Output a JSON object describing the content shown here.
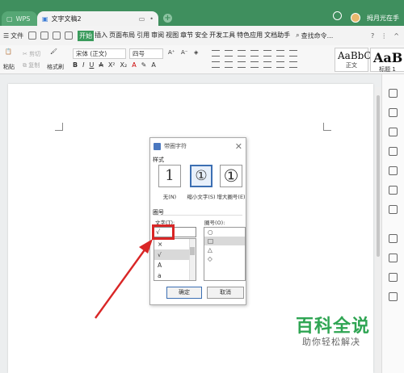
{
  "titlebar": {
    "app_tab": "WPS",
    "doc_tab": "文字文稿2",
    "user_name": "拇月光在手"
  },
  "menubar": {
    "file_label": "文件",
    "tabs": [
      "开始",
      "插入",
      "页面布局",
      "引用",
      "审阅",
      "视图",
      "章节",
      "安全",
      "开发工具",
      "特色应用",
      "文档助手"
    ],
    "search_label": "查找命令..."
  },
  "ribbon": {
    "paste_label": "粘贴",
    "cut_label": "剪切",
    "copy_label": "复制",
    "format_painter_label": "格式刷",
    "font_name": "宋体 (正文)",
    "font_size": "四号",
    "style_normal_sample": "AaBbC",
    "style_normal_label": "正文",
    "style_h1_sample": "AaB",
    "style_h1_label": "标题 1"
  },
  "dialog": {
    "title": "带圈字符",
    "style_section": "样式",
    "options": [
      {
        "glyph": "1",
        "label": "无(N)"
      },
      {
        "glyph": "①",
        "label": "缩小文字(S)"
      },
      {
        "glyph": "①",
        "label": "增大圈号(E)"
      }
    ],
    "circle_section": "圈号",
    "text_label": "文字(T):",
    "symbol_label": "圈号(O):",
    "text_value": "√",
    "char_list": [
      "×",
      "√",
      "A",
      "a"
    ],
    "symbol_list": [
      "○",
      "□",
      "△",
      "◇"
    ],
    "ok_label": "确定",
    "cancel_label": "取消"
  },
  "watermark": {
    "main": "百科全说",
    "sub": "助你轻松解决"
  }
}
